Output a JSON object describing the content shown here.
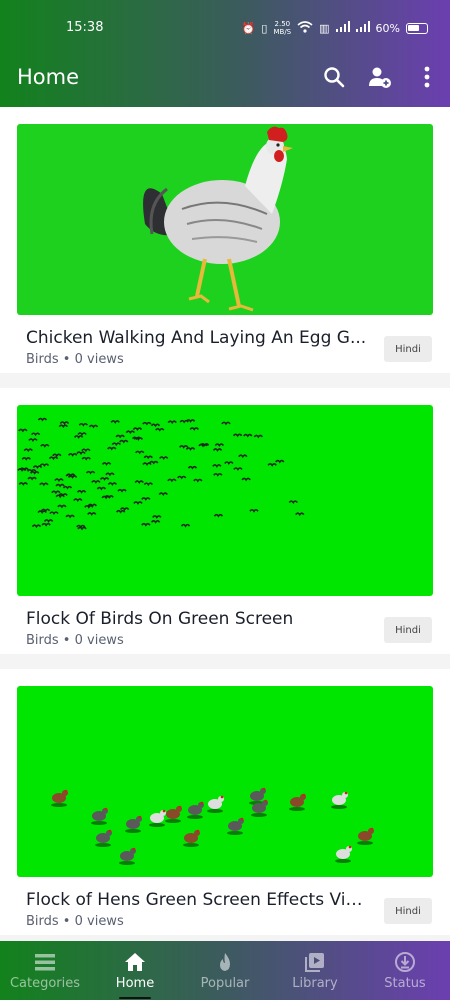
{
  "status_bar": {
    "time": "15:38",
    "net_speed": "2.50",
    "net_unit": "MB/S",
    "battery": "60%"
  },
  "app_bar": {
    "title": "Home"
  },
  "videos": [
    {
      "title": "Chicken Walking And Laying An Egg G...",
      "meta": "Birds • 0 views",
      "language": "Hindi"
    },
    {
      "title": "Flock Of Birds On Green Screen",
      "meta": "Birds • 0 views",
      "language": "Hindi"
    },
    {
      "title": "Flock of Hens Green Screen Effects Vid...",
      "meta": "Birds • 0 views",
      "language": "Hindi"
    }
  ],
  "bottom_nav": {
    "items": [
      {
        "label": "Categories",
        "icon": "list-icon"
      },
      {
        "label": "Home",
        "icon": "home-icon"
      },
      {
        "label": "Popular",
        "icon": "flame-icon"
      },
      {
        "label": "Library",
        "icon": "library-icon"
      },
      {
        "label": "Status",
        "icon": "download-circle-icon"
      }
    ],
    "active": "Home"
  },
  "colors": {
    "chroma_green": "#00e600",
    "chroma_green_dark": "#1ed11e",
    "gradient_start": "#12821c",
    "gradient_end": "#6b3fb0"
  }
}
